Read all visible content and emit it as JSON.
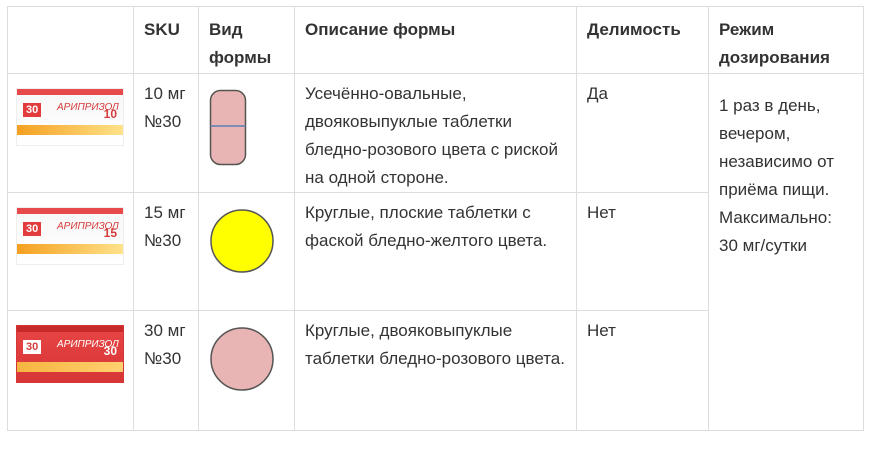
{
  "table": {
    "headers": [
      "",
      "SKU",
      "Вид формы",
      "Описание формы",
      "Делимость",
      "Режим дозирования"
    ],
    "rows": [
      {
        "pack": {
          "count": "30",
          "brand": "АРИПРИЗОЛ",
          "dose": "10"
        },
        "sku": "10 мг №30",
        "form_icon": "oblong-tablet-icon",
        "description": "Усечённо-овальные, двояковыпуклые таблетки бледно-розового цвета с риской на одной стороне.",
        "divisible": "Да"
      },
      {
        "pack": {
          "count": "30",
          "brand": "АРИПРИЗОЛ",
          "dose": "15"
        },
        "sku": "15 мг №30",
        "form_icon": "round-yellow-tablet-icon",
        "description": "Круглые, плоские таблетки с фаской бледно-желтого цвета.",
        "divisible": "Нет"
      },
      {
        "pack": {
          "count": "30",
          "brand": "АРИПРИЗОЛ",
          "dose": "30"
        },
        "sku": "30 мг №30",
        "form_icon": "round-pink-tablet-icon",
        "description": "Круглые, двояковыпуклые таблетки бледно-розового цвета.",
        "divisible": "Нет"
      }
    ],
    "dosing": "1 раз в день, вечером, независимо от приёма пищи. Максимально: 30 мг/сутки"
  },
  "colors": {
    "pink_tablet": "#e8b4b4",
    "yellow_tablet": "#ffff00",
    "tablet_outline": "#555555",
    "score_line": "#5b7fb3"
  }
}
